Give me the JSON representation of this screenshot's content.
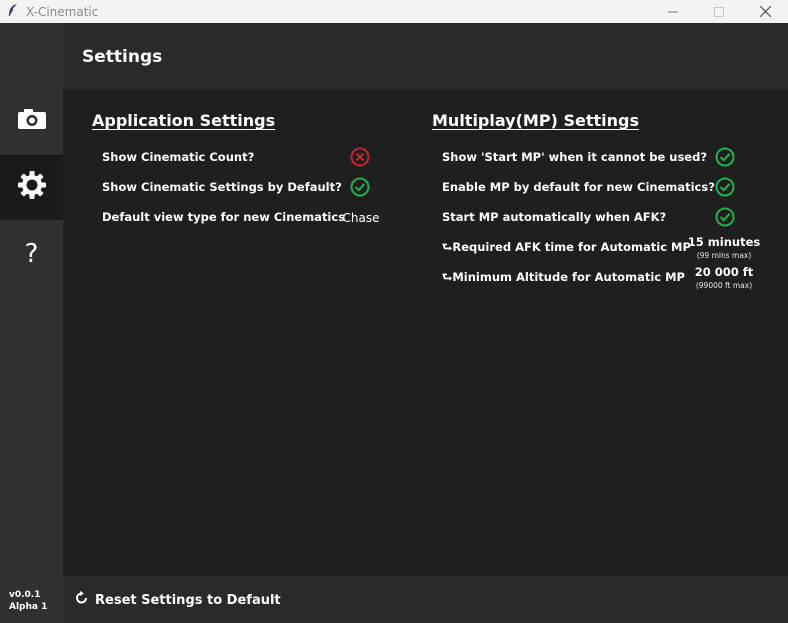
{
  "window": {
    "title": "X-Cinematic",
    "icon": "feather-icon",
    "controls": [
      "minimize",
      "maximize",
      "close"
    ]
  },
  "sidebar": {
    "items": [
      {
        "name": "cinematics",
        "icon": "camera-icon",
        "active": false
      },
      {
        "name": "settings",
        "icon": "gear-icon",
        "active": true
      },
      {
        "name": "help",
        "icon": "question-icon",
        "label": "?",
        "active": false
      }
    ],
    "version": "v0.0.1",
    "release": "Alpha 1"
  },
  "header": {
    "title": "Settings"
  },
  "application_settings": {
    "title": "Application Settings",
    "rows": [
      {
        "label": "Show Cinematic Count?",
        "value": false
      },
      {
        "label": "Show Cinematic Settings by Default?",
        "value": true
      },
      {
        "label": "Default view type for new Cinematics",
        "value": "Chase"
      }
    ]
  },
  "mp_settings": {
    "title": "Multiplay(MP) Settings",
    "rows": [
      {
        "label": "Show 'Start MP' when it cannot be used?",
        "value": true
      },
      {
        "label": "Enable MP by default for new Cinematics?",
        "value": true
      },
      {
        "label": "Start MP automatically when AFK?",
        "value": true
      },
      {
        "label": "⮑Required AFK time for Automatic MP",
        "value": "15 minutes",
        "hint": "(99 mins max)"
      },
      {
        "label": "⮑Minimum Altitude for Automatic MP",
        "value": "20 000 ft",
        "hint": "(99000 ft max)"
      }
    ]
  },
  "footer": {
    "reset_label": "Reset Settings to Default",
    "reset_icon": "reset-icon"
  },
  "colors": {
    "enabled": "#22b14c",
    "disabled": "#c0282b",
    "sidebar_bg": "#303030",
    "active_bg": "#1a1a1a",
    "header_bg": "#2a2a2a"
  }
}
